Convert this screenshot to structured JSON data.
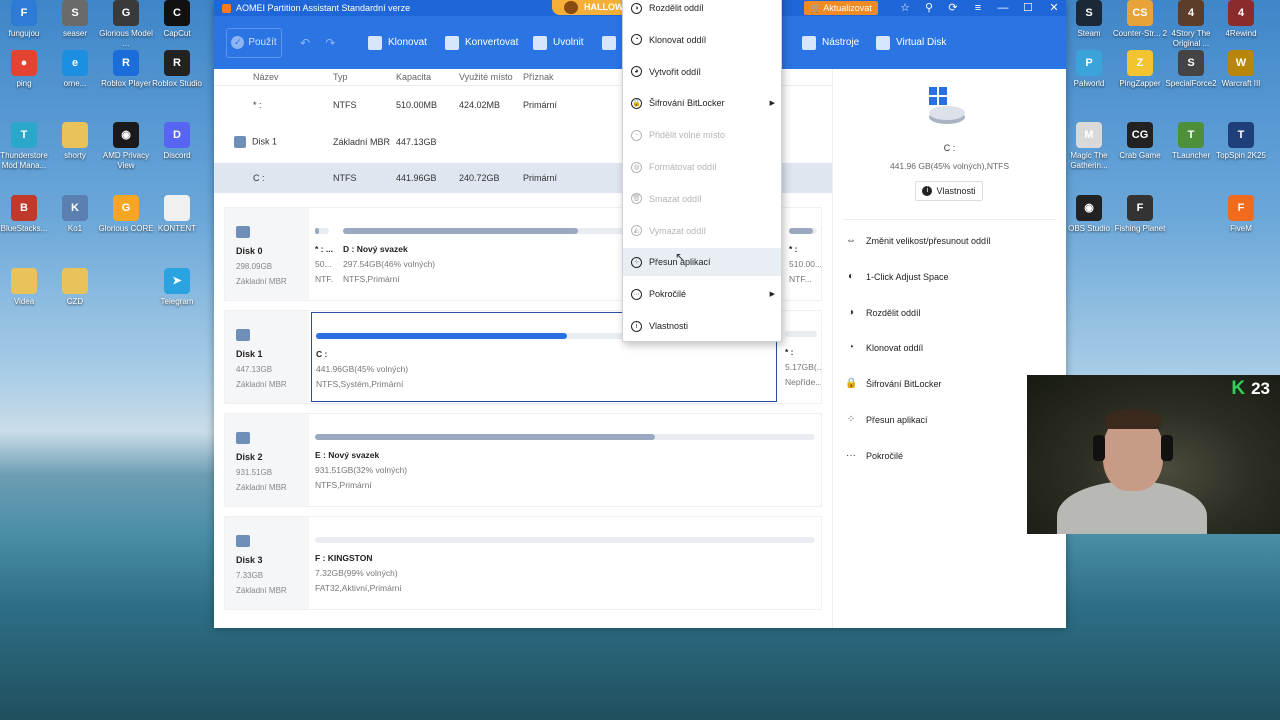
{
  "desktop": {
    "left_icons": [
      {
        "label": "fungujou",
        "color": "#2e7bd6",
        "glyph": "F"
      },
      {
        "label": "seaser",
        "color": "#6a6a6a",
        "glyph": "S"
      },
      {
        "label": "Glorious Model ...",
        "color": "#3a3a3a",
        "glyph": "G"
      },
      {
        "label": "CapCut",
        "color": "#111111",
        "glyph": "C"
      },
      {
        "label": "ping",
        "color": "#e44332",
        "glyph": "●"
      },
      {
        "label": "orne...",
        "color": "#1d8fe0",
        "glyph": "e"
      },
      {
        "label": "Roblox Player",
        "color": "#1b6dd9",
        "glyph": "R"
      },
      {
        "label": "Roblox Studio",
        "color": "#222222",
        "glyph": "R"
      },
      {
        "label": "Thunderstore Mod Mana...",
        "color": "#2aa7c9",
        "glyph": "T"
      },
      {
        "label": "shorty",
        "color": "#e9c25a",
        "glyph": ""
      },
      {
        "label": "AMD Privacy View",
        "color": "#1a1a1a",
        "glyph": "◉"
      },
      {
        "label": "Discord",
        "color": "#5865f2",
        "glyph": "D"
      },
      {
        "label": "BlueStacks...",
        "color": "#c0392b",
        "glyph": "B"
      },
      {
        "label": "Ko1",
        "color": "#5a7fb0",
        "glyph": "K"
      },
      {
        "label": "Glorious CORE",
        "color": "#f5a623",
        "glyph": "G"
      },
      {
        "label": "KONTENT",
        "color": "#f0f0f0",
        "glyph": ""
      },
      {
        "label": "Videa",
        "color": "#e9c25a",
        "glyph": ""
      },
      {
        "label": "CZD",
        "color": "#e9c25a",
        "glyph": ""
      },
      {
        "label": "Telegram",
        "color": "#2aa3e0",
        "glyph": "➤"
      }
    ],
    "right_icons": [
      {
        "label": "Steam",
        "color": "#1b2838",
        "glyph": "S"
      },
      {
        "label": "Counter-Str... 2",
        "color": "#e8a23a",
        "glyph": "CS"
      },
      {
        "label": "4Story The Original ...",
        "color": "#5b3d2a",
        "glyph": "4"
      },
      {
        "label": "4Rewind",
        "color": "#8b2b2b",
        "glyph": "4"
      },
      {
        "label": "Palworld",
        "color": "#3ba3d9",
        "glyph": "P"
      },
      {
        "label": "PingZapper",
        "color": "#f4c430",
        "glyph": "Z"
      },
      {
        "label": "SpecialForce2",
        "color": "#444444",
        "glyph": "S"
      },
      {
        "label": "Warcraft III",
        "color": "#b8860b",
        "glyph": "W"
      },
      {
        "label": "Magic The Gatherin...",
        "color": "#d9d9d9",
        "glyph": "M"
      },
      {
        "label": "Crab Game",
        "color": "#222222",
        "glyph": "CG"
      },
      {
        "label": "TLauncher",
        "color": "#4d8f3a",
        "glyph": "T"
      },
      {
        "label": "TopSpin 2K25",
        "color": "#1f3f7a",
        "glyph": "T"
      },
      {
        "label": "OBS Studio",
        "color": "#222222",
        "glyph": "◉"
      },
      {
        "label": "Fishing Planet",
        "color": "#333333",
        "glyph": "F"
      },
      {
        "label": "FiveM",
        "color": "#f26a1b",
        "glyph": "F"
      }
    ]
  },
  "app": {
    "title": "AOMEI Partition Assistant Standardní verze",
    "promo_label": "HALLOW",
    "upgrade_label": "Aktualizovat",
    "toolbar": {
      "apply": "Použít",
      "undo_redo": "↶ ↷",
      "clone": "Klonovat",
      "convert": "Konvertovat",
      "free": "Uvolnit",
      "tools": "Nástroje",
      "virtual_disk": "Virtual Disk"
    },
    "table": {
      "headers": [
        "Název",
        "Typ",
        "Kapacita",
        "Využité místo",
        "Příznak"
      ],
      "rows": [
        [
          "* :",
          "NTFS",
          "510.00MB",
          "424.02MB",
          "Primární"
        ],
        [
          "Disk 1",
          "Základní MBR",
          "447.13GB",
          "",
          ""
        ],
        [
          "C :",
          "NTFS",
          "441.96GB",
          "240.72GB",
          "Primární"
        ]
      ]
    },
    "disks": [
      {
        "name": "Disk 0",
        "size": "298.09GB",
        "type": "Základní MBR",
        "parts": [
          {
            "name": "* : ...",
            "detail": "50...",
            "fs": "NTF...",
            "fill": 0.3
          },
          {
            "name": "D : Nový svazek",
            "detail": "297.54GB(46% volných)",
            "fs": "NTFS,Primární",
            "fill": 0.54
          },
          {
            "name": "* :",
            "detail": "510.00...",
            "fs": "NTF...",
            "fill": 0.85
          }
        ]
      },
      {
        "name": "Disk 1",
        "size": "447.13GB",
        "type": "Základní MBR",
        "parts": [
          {
            "name": "C :",
            "detail": "441.96GB(45% volných)",
            "fs": "NTFS,Systém,Primární",
            "fill": 0.55
          },
          {
            "name": "* :",
            "detail": "5.17GB(...",
            "fs": "Nepříde...",
            "fill": 0.0
          }
        ]
      },
      {
        "name": "Disk 2",
        "size": "931.51GB",
        "type": "Základní MBR",
        "parts": [
          {
            "name": "E : Nový svazek",
            "detail": "931.51GB(32% volných)",
            "fs": "NTFS,Primární",
            "fill": 0.68
          }
        ]
      },
      {
        "name": "Disk 3",
        "size": "7.33GB",
        "type": "Základní MBR",
        "parts": [
          {
            "name": "F : KINGSTON",
            "detail": "7.32GB(99% volných)",
            "fs": "FAT32,Aktivní,Primární",
            "fill": 0.0
          }
        ]
      }
    ],
    "right_panel": {
      "name": "C :",
      "size": "441.96 GB(45% volných),NTFS",
      "properties": "Vlastnosti",
      "actions": [
        {
          "label": "Změnit velikost/přesunout oddíl",
          "icon": "⇔"
        },
        {
          "label": "1-Click Adjust Space",
          "icon": "◐"
        },
        {
          "label": "Rozdělit oddíl",
          "icon": "◑"
        },
        {
          "label": "Klonovat oddíl",
          "icon": "◔"
        },
        {
          "label": "Šifrování BitLocker",
          "icon": "🔒"
        },
        {
          "label": "Přesun aplikací",
          "icon": "⁘"
        },
        {
          "label": "Pokročilé",
          "icon": "···"
        }
      ]
    },
    "context_menu": [
      {
        "label": "Rozdělit oddíl",
        "disabled": false,
        "sub": false,
        "icon": "◑"
      },
      {
        "label": "Klonovat oddíl",
        "disabled": false,
        "sub": false,
        "icon": "◔"
      },
      {
        "label": "Vytvořit oddíl",
        "disabled": false,
        "sub": false,
        "icon": "◕"
      },
      {
        "label": "Šifrování BitLocker",
        "disabled": false,
        "sub": true,
        "icon": "🔒"
      },
      {
        "label": "Přidělit volné místo",
        "disabled": true,
        "sub": false,
        "icon": "◔"
      },
      {
        "label": "Formátovat oddíl",
        "disabled": true,
        "sub": false,
        "icon": "◍"
      },
      {
        "label": "Smazat oddíl",
        "disabled": true,
        "sub": false,
        "icon": "🗑"
      },
      {
        "label": "Vymazat oddíl",
        "disabled": true,
        "sub": false,
        "icon": "◭"
      },
      {
        "label": "Přesun aplikací",
        "disabled": false,
        "sub": false,
        "icon": "⁘",
        "highlight": true
      },
      {
        "label": "Pokročilé",
        "disabled": false,
        "sub": true,
        "icon": "···"
      },
      {
        "label": "Vlastnosti",
        "disabled": false,
        "sub": false,
        "icon": "i"
      }
    ]
  },
  "webcam": {
    "badge_letter": "K",
    "badge_count": "23"
  }
}
